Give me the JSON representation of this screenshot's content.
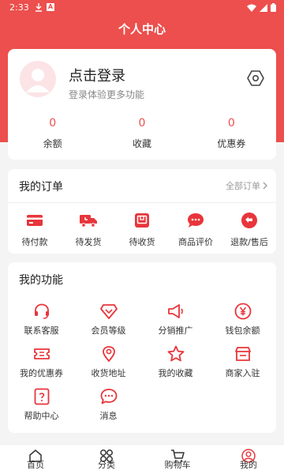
{
  "status_bar": {
    "time": "2:33"
  },
  "header": {
    "title": "个人中心"
  },
  "profile": {
    "login_title": "点击登录",
    "login_subtitle": "登录体验更多功能",
    "stats": [
      {
        "value": "0",
        "label": "余额"
      },
      {
        "value": "0",
        "label": "收藏"
      },
      {
        "value": "0",
        "label": "优惠券"
      }
    ]
  },
  "orders": {
    "title": "我的订单",
    "all_link": "全部订单",
    "items": [
      {
        "label": "待付款",
        "icon": "wallet-icon"
      },
      {
        "label": "待发货",
        "icon": "truck-icon"
      },
      {
        "label": "待收货",
        "icon": "package-icon"
      },
      {
        "label": "商品评价",
        "icon": "comment-icon"
      },
      {
        "label": "退款/售后",
        "icon": "refund-icon"
      }
    ]
  },
  "functions": {
    "title": "我的功能",
    "items": [
      {
        "label": "联系客服",
        "icon": "headset-icon"
      },
      {
        "label": "会员等级",
        "icon": "diamond-icon"
      },
      {
        "label": "分销推广",
        "icon": "megaphone-icon"
      },
      {
        "label": "钱包余额",
        "icon": "yen-coin-icon"
      },
      {
        "label": "我的优惠券",
        "icon": "coupon-icon"
      },
      {
        "label": "收货地址",
        "icon": "location-icon"
      },
      {
        "label": "我的收藏",
        "icon": "star-icon"
      },
      {
        "label": "商家入驻",
        "icon": "store-icon"
      },
      {
        "label": "帮助中心",
        "icon": "help-icon"
      },
      {
        "label": "消息",
        "icon": "message-icon"
      }
    ]
  },
  "tabbar": {
    "items": [
      {
        "label": "首页",
        "icon": "home-icon"
      },
      {
        "label": "分类",
        "icon": "category-icon"
      },
      {
        "label": "购物车",
        "icon": "cart-icon"
      },
      {
        "label": "我的",
        "icon": "profile-icon"
      }
    ]
  },
  "colors": {
    "brand": "#ec4f4d",
    "background": "#f4f4f4",
    "avatar_bg": "#fbe3e6"
  }
}
